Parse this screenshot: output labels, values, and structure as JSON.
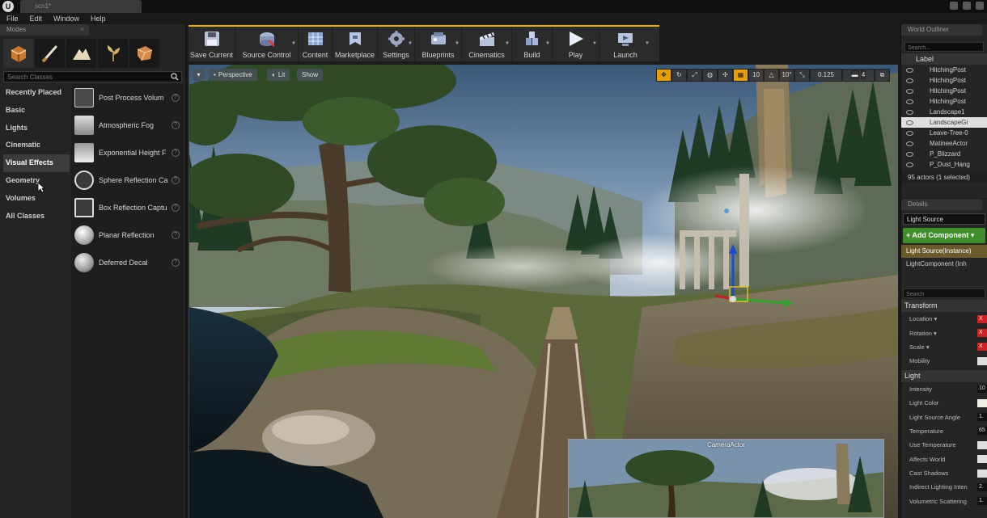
{
  "window": {
    "tab_title": "scn1*",
    "menu": [
      "File",
      "Edit",
      "Window",
      "Help"
    ]
  },
  "modes_panel": {
    "tab": "Modes",
    "search_placeholder": "Search Classes",
    "categories": [
      "Recently Placed",
      "Basic",
      "Lights",
      "Cinematic",
      "Visual Effects",
      "Geometry",
      "Volumes",
      "All Classes"
    ],
    "selected_category": "Visual Effects",
    "items": [
      "Post Process Volum",
      "Atmospheric Fog",
      "Exponential Height F",
      "Sphere Reflection Ca",
      "Box Reflection Captu",
      "Planar Reflection",
      "Deferred Decal"
    ]
  },
  "toolbar": {
    "buttons": [
      {
        "label": "Save Current",
        "icon": "save-icon"
      },
      {
        "label": "Source Control",
        "icon": "source-control-icon"
      },
      {
        "label": "Content",
        "icon": "content-icon"
      },
      {
        "label": "Marketplace",
        "icon": "marketplace-icon"
      },
      {
        "label": "Settings",
        "icon": "settings-icon"
      },
      {
        "label": "Blueprints",
        "icon": "blueprints-icon"
      },
      {
        "label": "Cinematics",
        "icon": "cinematics-icon"
      },
      {
        "label": "Build",
        "icon": "build-icon"
      },
      {
        "label": "Play",
        "icon": "play-icon"
      },
      {
        "label": "Launch",
        "icon": "launch-icon"
      }
    ]
  },
  "viewport": {
    "view_mode": "Perspective",
    "lit": "Lit",
    "show": "Show",
    "grid_snap": "10",
    "rotation_snap": "10°",
    "scale_snap": "0.125",
    "camera_speed": "4",
    "pip_title": "CameraActor"
  },
  "world_outliner": {
    "tab": "World Outliner",
    "search_placeholder": "Search...",
    "column_label": "Label",
    "rows": [
      "HitchingPost",
      "HitchingPost",
      "HitchingPost",
      "HitchingPost",
      "Landscape1",
      "LandscapeGi",
      "Leave-Tree-0",
      "MatineeActor",
      "P_Blizzard",
      "P_Dust_Hang"
    ],
    "selected_row": 5,
    "footer": "95 actors (1 selected)"
  },
  "details": {
    "tab": "Details",
    "name": "Light Source",
    "add_component": "+ Add Component ▾",
    "components": [
      "Light Source(Instance)",
      "LightComponent (Inh"
    ],
    "search_placeholder": "Search",
    "transform_header": "Transform",
    "transform_props": [
      {
        "label": "Location ▾",
        "value": "X"
      },
      {
        "label": "Rotation ▾",
        "value": "X"
      },
      {
        "label": "Scale ▾",
        "value": "X"
      },
      {
        "label": "Mobility",
        "value": ""
      }
    ],
    "light_header": "Light",
    "light_props": [
      {
        "label": "Intensity",
        "value": "10"
      },
      {
        "label": "Light Color",
        "value": ""
      },
      {
        "label": "Light Source Angle",
        "value": "1."
      },
      {
        "label": "Temperature",
        "value": "65"
      },
      {
        "label": "Use Temperature",
        "value": ""
      },
      {
        "label": "Affects World",
        "value": ""
      },
      {
        "label": "Cast Shadows",
        "value": ""
      },
      {
        "label": "Indirect Lighting Inten",
        "value": "2."
      },
      {
        "label": "Volumetric Scattering",
        "value": "1."
      }
    ]
  },
  "colors": {
    "toolbar_accent": "#e8b100",
    "add_component": "#3e8f2a",
    "selection": "#e0e0e0"
  }
}
